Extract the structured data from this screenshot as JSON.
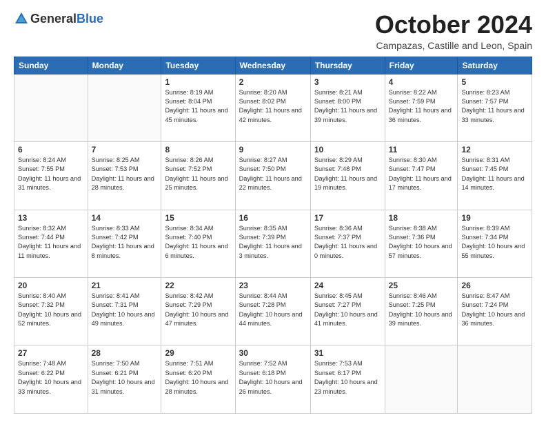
{
  "header": {
    "logo_general": "General",
    "logo_blue": "Blue",
    "month_title": "October 2024",
    "location": "Campazas, Castille and Leon, Spain"
  },
  "weekdays": [
    "Sunday",
    "Monday",
    "Tuesday",
    "Wednesday",
    "Thursday",
    "Friday",
    "Saturday"
  ],
  "weeks": [
    [
      {
        "day": "",
        "info": ""
      },
      {
        "day": "",
        "info": ""
      },
      {
        "day": "1",
        "info": "Sunrise: 8:19 AM\nSunset: 8:04 PM\nDaylight: 11 hours and 45 minutes."
      },
      {
        "day": "2",
        "info": "Sunrise: 8:20 AM\nSunset: 8:02 PM\nDaylight: 11 hours and 42 minutes."
      },
      {
        "day": "3",
        "info": "Sunrise: 8:21 AM\nSunset: 8:00 PM\nDaylight: 11 hours and 39 minutes."
      },
      {
        "day": "4",
        "info": "Sunrise: 8:22 AM\nSunset: 7:59 PM\nDaylight: 11 hours and 36 minutes."
      },
      {
        "day": "5",
        "info": "Sunrise: 8:23 AM\nSunset: 7:57 PM\nDaylight: 11 hours and 33 minutes."
      }
    ],
    [
      {
        "day": "6",
        "info": "Sunrise: 8:24 AM\nSunset: 7:55 PM\nDaylight: 11 hours and 31 minutes."
      },
      {
        "day": "7",
        "info": "Sunrise: 8:25 AM\nSunset: 7:53 PM\nDaylight: 11 hours and 28 minutes."
      },
      {
        "day": "8",
        "info": "Sunrise: 8:26 AM\nSunset: 7:52 PM\nDaylight: 11 hours and 25 minutes."
      },
      {
        "day": "9",
        "info": "Sunrise: 8:27 AM\nSunset: 7:50 PM\nDaylight: 11 hours and 22 minutes."
      },
      {
        "day": "10",
        "info": "Sunrise: 8:29 AM\nSunset: 7:48 PM\nDaylight: 11 hours and 19 minutes."
      },
      {
        "day": "11",
        "info": "Sunrise: 8:30 AM\nSunset: 7:47 PM\nDaylight: 11 hours and 17 minutes."
      },
      {
        "day": "12",
        "info": "Sunrise: 8:31 AM\nSunset: 7:45 PM\nDaylight: 11 hours and 14 minutes."
      }
    ],
    [
      {
        "day": "13",
        "info": "Sunrise: 8:32 AM\nSunset: 7:44 PM\nDaylight: 11 hours and 11 minutes."
      },
      {
        "day": "14",
        "info": "Sunrise: 8:33 AM\nSunset: 7:42 PM\nDaylight: 11 hours and 8 minutes."
      },
      {
        "day": "15",
        "info": "Sunrise: 8:34 AM\nSunset: 7:40 PM\nDaylight: 11 hours and 6 minutes."
      },
      {
        "day": "16",
        "info": "Sunrise: 8:35 AM\nSunset: 7:39 PM\nDaylight: 11 hours and 3 minutes."
      },
      {
        "day": "17",
        "info": "Sunrise: 8:36 AM\nSunset: 7:37 PM\nDaylight: 11 hours and 0 minutes."
      },
      {
        "day": "18",
        "info": "Sunrise: 8:38 AM\nSunset: 7:36 PM\nDaylight: 10 hours and 57 minutes."
      },
      {
        "day": "19",
        "info": "Sunrise: 8:39 AM\nSunset: 7:34 PM\nDaylight: 10 hours and 55 minutes."
      }
    ],
    [
      {
        "day": "20",
        "info": "Sunrise: 8:40 AM\nSunset: 7:32 PM\nDaylight: 10 hours and 52 minutes."
      },
      {
        "day": "21",
        "info": "Sunrise: 8:41 AM\nSunset: 7:31 PM\nDaylight: 10 hours and 49 minutes."
      },
      {
        "day": "22",
        "info": "Sunrise: 8:42 AM\nSunset: 7:29 PM\nDaylight: 10 hours and 47 minutes."
      },
      {
        "day": "23",
        "info": "Sunrise: 8:44 AM\nSunset: 7:28 PM\nDaylight: 10 hours and 44 minutes."
      },
      {
        "day": "24",
        "info": "Sunrise: 8:45 AM\nSunset: 7:27 PM\nDaylight: 10 hours and 41 minutes."
      },
      {
        "day": "25",
        "info": "Sunrise: 8:46 AM\nSunset: 7:25 PM\nDaylight: 10 hours and 39 minutes."
      },
      {
        "day": "26",
        "info": "Sunrise: 8:47 AM\nSunset: 7:24 PM\nDaylight: 10 hours and 36 minutes."
      }
    ],
    [
      {
        "day": "27",
        "info": "Sunrise: 7:48 AM\nSunset: 6:22 PM\nDaylight: 10 hours and 33 minutes."
      },
      {
        "day": "28",
        "info": "Sunrise: 7:50 AM\nSunset: 6:21 PM\nDaylight: 10 hours and 31 minutes."
      },
      {
        "day": "29",
        "info": "Sunrise: 7:51 AM\nSunset: 6:20 PM\nDaylight: 10 hours and 28 minutes."
      },
      {
        "day": "30",
        "info": "Sunrise: 7:52 AM\nSunset: 6:18 PM\nDaylight: 10 hours and 26 minutes."
      },
      {
        "day": "31",
        "info": "Sunrise: 7:53 AM\nSunset: 6:17 PM\nDaylight: 10 hours and 23 minutes."
      },
      {
        "day": "",
        "info": ""
      },
      {
        "day": "",
        "info": ""
      }
    ]
  ]
}
